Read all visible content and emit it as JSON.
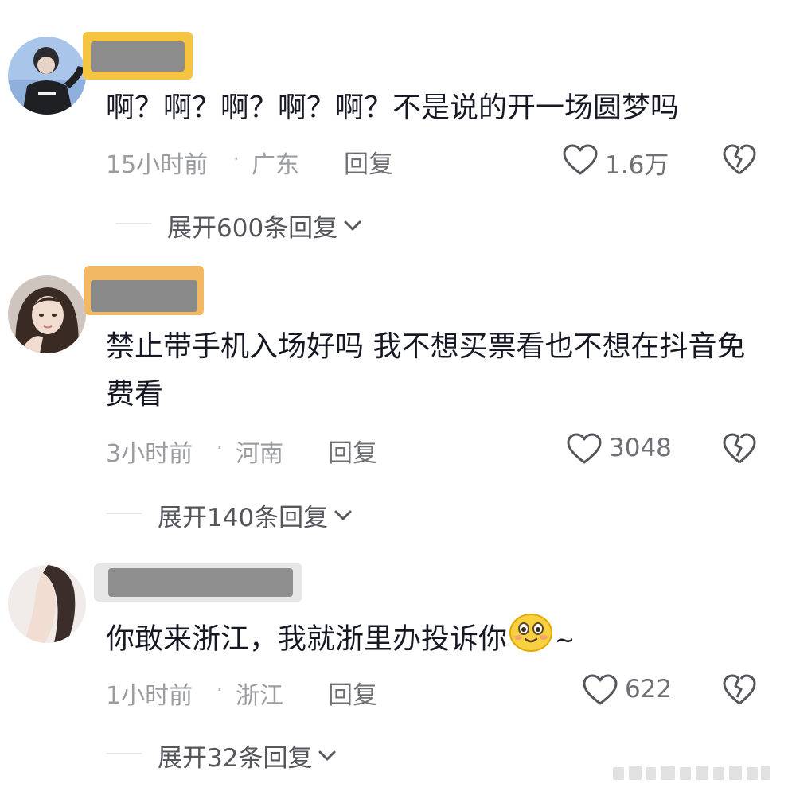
{
  "comments": [
    {
      "text": "啊？啊？啊？啊？啊？不是说的开一场圆梦吗",
      "time": "15小时前",
      "location": "广东",
      "reply_label": "回复",
      "likes": "1.6万",
      "expand_label": "展开600条回复",
      "redaction_color": "#f5c542"
    },
    {
      "text": "禁止带手机入场好吗 我不想买票看也不想在抖音免费看",
      "time": "3小时前",
      "location": "河南",
      "reply_label": "回复",
      "likes": "3048",
      "expand_label": "展开140条回复",
      "redaction_color": "#f3b862"
    },
    {
      "text": "你敢来浙江，我就浙里办投诉你",
      "text_suffix": "~",
      "emoji": "smiling-face-icon",
      "time": "1小时前",
      "location": "浙江",
      "reply_label": "回复",
      "likes": "622",
      "expand_label": "展开32条回复",
      "redaction_color": "#d8d8d8"
    }
  ],
  "colors": {
    "text": "#161823",
    "meta": "#9b9ca1",
    "action": "#6f7076"
  }
}
